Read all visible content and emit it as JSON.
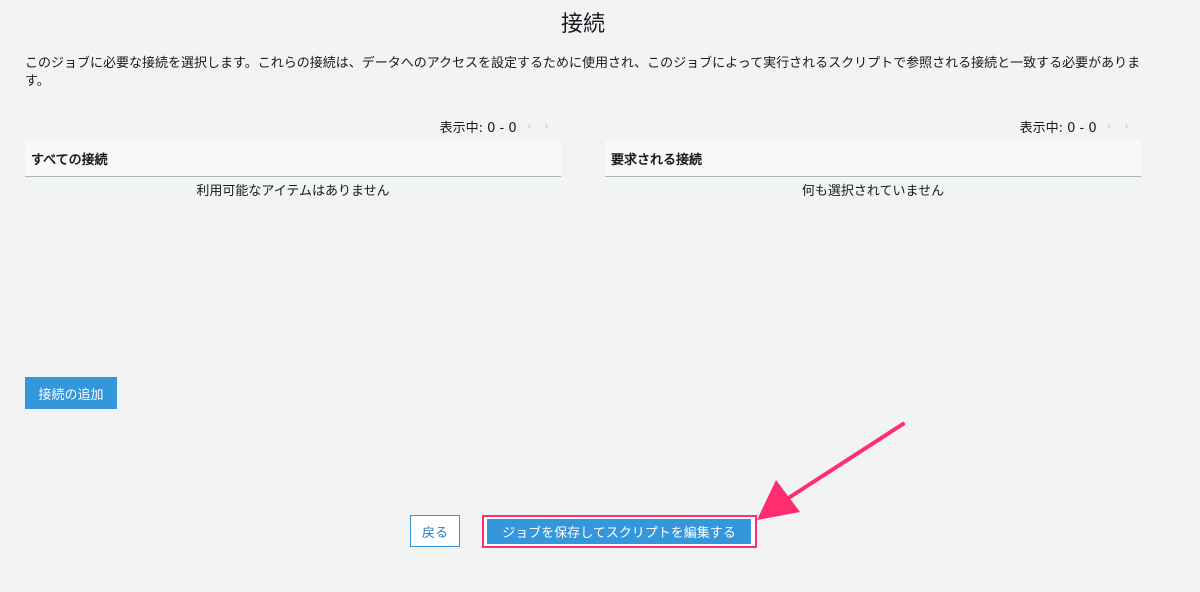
{
  "page": {
    "title": "接続",
    "description": "このジョブに必要な接続を選択します。これらの接続は、データへのアクセスを設定するために使用され、このジョブによって実行されるスクリプトで参照される接続と一致する必要があります。"
  },
  "all_connections": {
    "pager_text": "表示中: 0 - 0",
    "header": "すべての接続",
    "empty_text": "利用可能なアイテムはありません"
  },
  "required_connections": {
    "pager_text": "表示中: 0 - 0",
    "header": "要求される接続",
    "empty_text": "何も選択されていません"
  },
  "buttons": {
    "add_connection": "接続の追加",
    "back": "戻る",
    "save_and_edit": "ジョブを保存してスクリプトを編集する"
  },
  "icons": {
    "prev": "chevron-left-icon",
    "next": "chevron-right-icon"
  },
  "colors": {
    "primary": "#3497db",
    "annotation": "#ff2d6f",
    "background": "#f2f3f3"
  }
}
